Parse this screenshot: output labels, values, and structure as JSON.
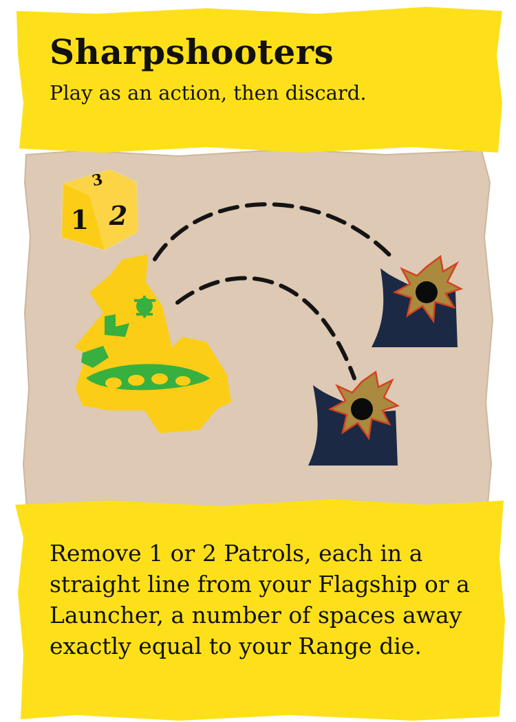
{
  "card": {
    "title": "Sharpshooters",
    "subtitle": "Play as an action, then discard.",
    "rule_text": "Remove 1 or 2 Patrols, each in a straight line from your Flagship or a Launcher, a number of spaces away exactly equal to your Range die."
  },
  "die": {
    "faces": [
      "3",
      "1",
      "2"
    ]
  },
  "colors": {
    "band_yellow": "#fde01a",
    "parchment": "#ddc9b4",
    "ship_yellow": "#fbcd16",
    "ship_green": "#37b03f",
    "patrol_navy": "#1b2945",
    "explosion_tan": "#a98a3f",
    "explosion_red": "#d4421f"
  },
  "icons": {
    "ship": "flagship-ship-icon",
    "patrols": "patrol-ship-icon",
    "explosions": "explosion-icon",
    "die": "range-die-icon"
  }
}
